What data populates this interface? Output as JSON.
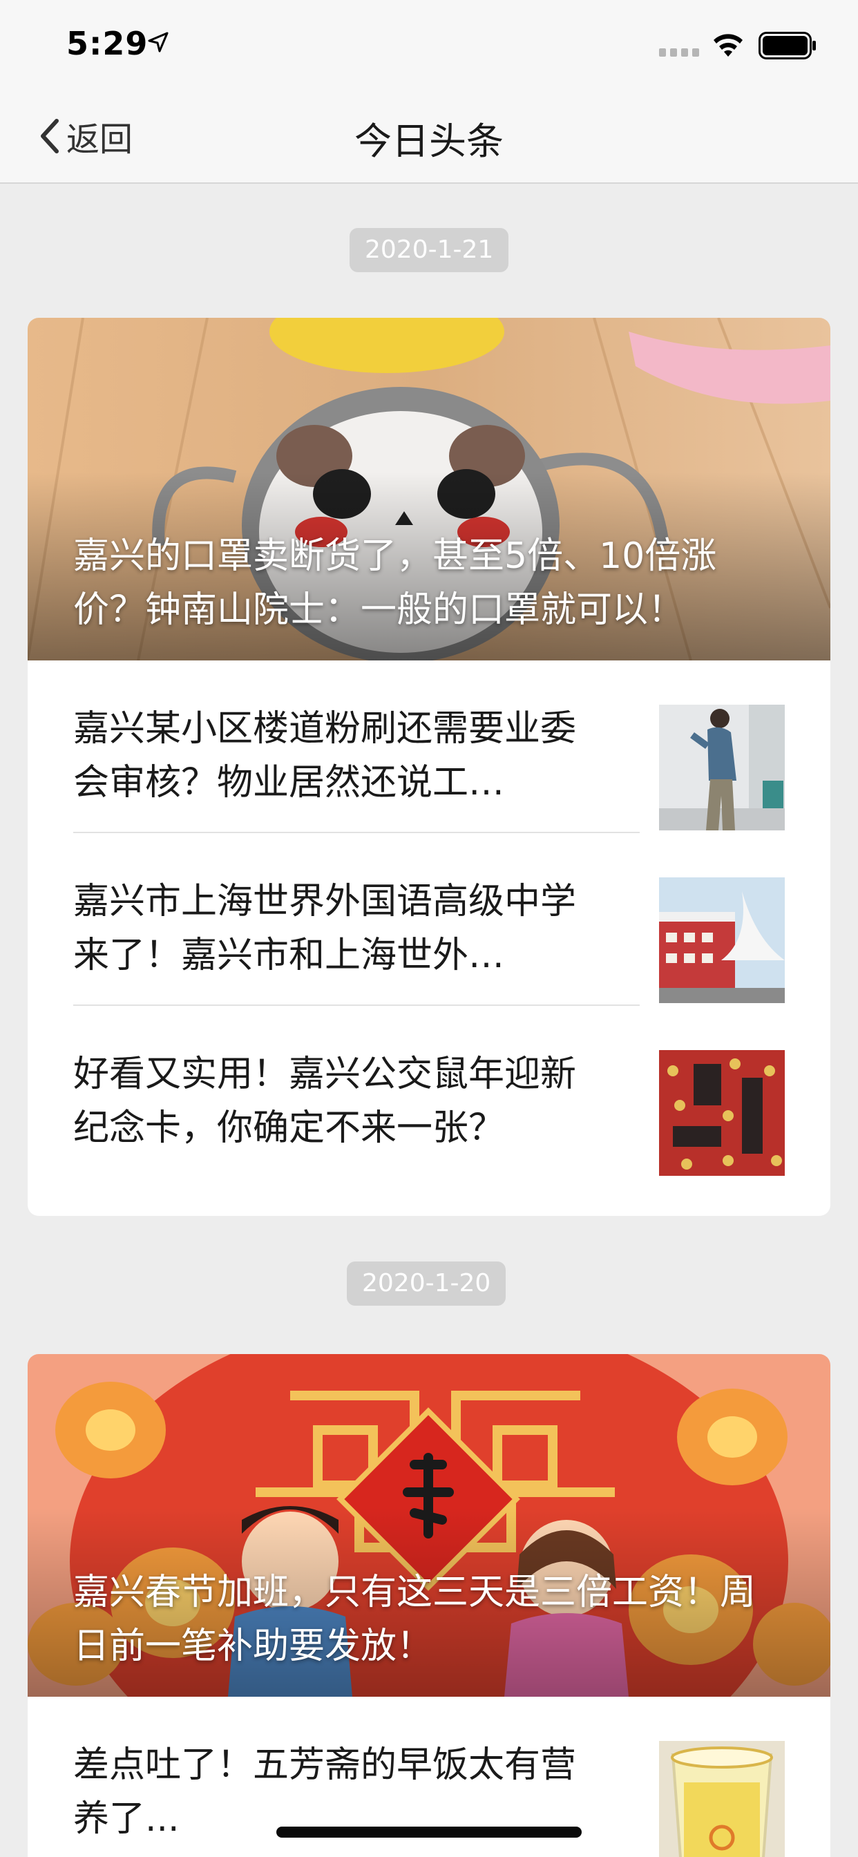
{
  "status_bar": {
    "time": "5:29",
    "icons": [
      "location-arrow-icon",
      "cellular-signal-icon",
      "wifi-icon",
      "battery-icon"
    ]
  },
  "nav": {
    "back_label": "返回",
    "title": "今日头条"
  },
  "sections": [
    {
      "date": "2020-1-21",
      "hero": {
        "caption": "嘉兴的口罩卖断货了，甚至5倍、10倍涨价？钟南山院士：一般的口罩就可以！"
      },
      "items": [
        {
          "title": "嘉兴某小区楼道粉刷还需要业委会审核？物业居然还说工…"
        },
        {
          "title": "嘉兴市上海世界外国语高级中学来了！嘉兴市和上海世外…"
        },
        {
          "title": "好看又实用！嘉兴公交鼠年迎新纪念卡，你确定不来一张？"
        }
      ]
    },
    {
      "date": "2020-1-20",
      "hero": {
        "caption": "嘉兴春节加班，只有这三天是三倍工资！周日前一笔补助要发放！"
      },
      "items": [
        {
          "title": "差点吐了！五芳斋的早饭太有营养了..."
        }
      ]
    }
  ],
  "colors": {
    "background": "#ededed",
    "nav_background": "#f7f7f7",
    "date_pill": "#d2d2d2",
    "card": "#ffffff"
  }
}
